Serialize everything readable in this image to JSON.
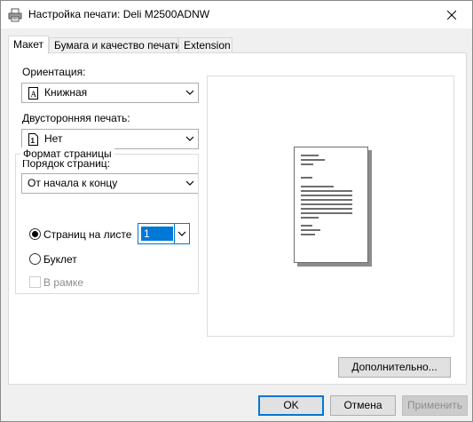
{
  "window": {
    "title": "Настройка печати: Deli M2500ADNW",
    "icons": {
      "app": "printer-icon",
      "close": "close-icon"
    }
  },
  "tabs": [
    {
      "label": "Макет",
      "active": true
    },
    {
      "label": "Бумага и качество печати",
      "active": false
    },
    {
      "label": "Extension",
      "active": false
    }
  ],
  "layout": {
    "orientation": {
      "label": "Ориентация:",
      "value": "Книжная",
      "icon": "portrait-page-icon"
    },
    "duplex": {
      "label": "Двусторонняя печать:",
      "value": "Нет",
      "icon": "simplex-page-icon"
    },
    "page_order": {
      "label": "Порядок страниц:",
      "value": "От начала к концу"
    },
    "page_format": {
      "title": "Формат страницы",
      "pages_per_sheet": {
        "label": "Страниц на листе",
        "checked": true,
        "value": "1"
      },
      "booklet": {
        "label": "Буклет",
        "checked": false
      },
      "border": {
        "label": "В рамке",
        "checked": false,
        "enabled": false
      }
    }
  },
  "buttons": {
    "advanced": "Дополнительно...",
    "ok": "OK",
    "cancel": "Отмена",
    "apply": "Применить"
  },
  "colors": {
    "accent": "#0078d7",
    "disabled_text": "#8d8d8d"
  }
}
